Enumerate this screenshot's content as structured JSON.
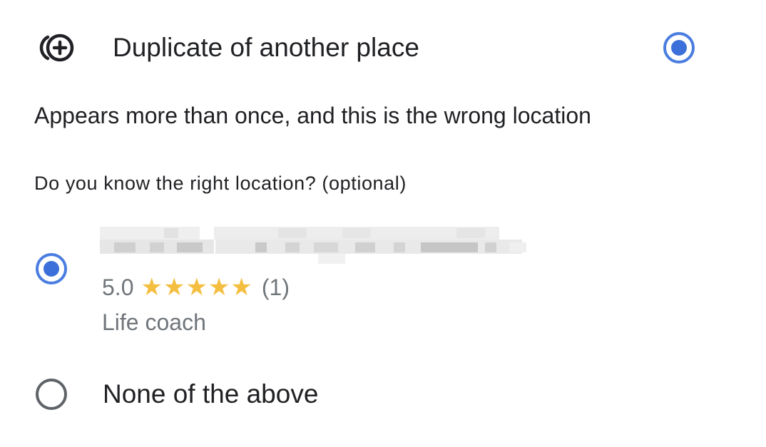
{
  "header": {
    "icon": "add-location-icon",
    "title": "Duplicate of another place",
    "selected": true
  },
  "description": "Appears more than once, and this is the wrong location",
  "question": "Do you know the right location? (optional)",
  "options": [
    {
      "name": "",
      "name_redacted": true,
      "rating": "5.0",
      "stars": "★★★★★",
      "review_count": "(1)",
      "category": "Life coach",
      "selected": true
    },
    {
      "label": "None of the above",
      "selected": false
    }
  ],
  "colors": {
    "accent": "#3b6fd9",
    "star": "#f4bf41",
    "secondary_text": "#70757a",
    "unchecked_radio": "#5f6368"
  }
}
